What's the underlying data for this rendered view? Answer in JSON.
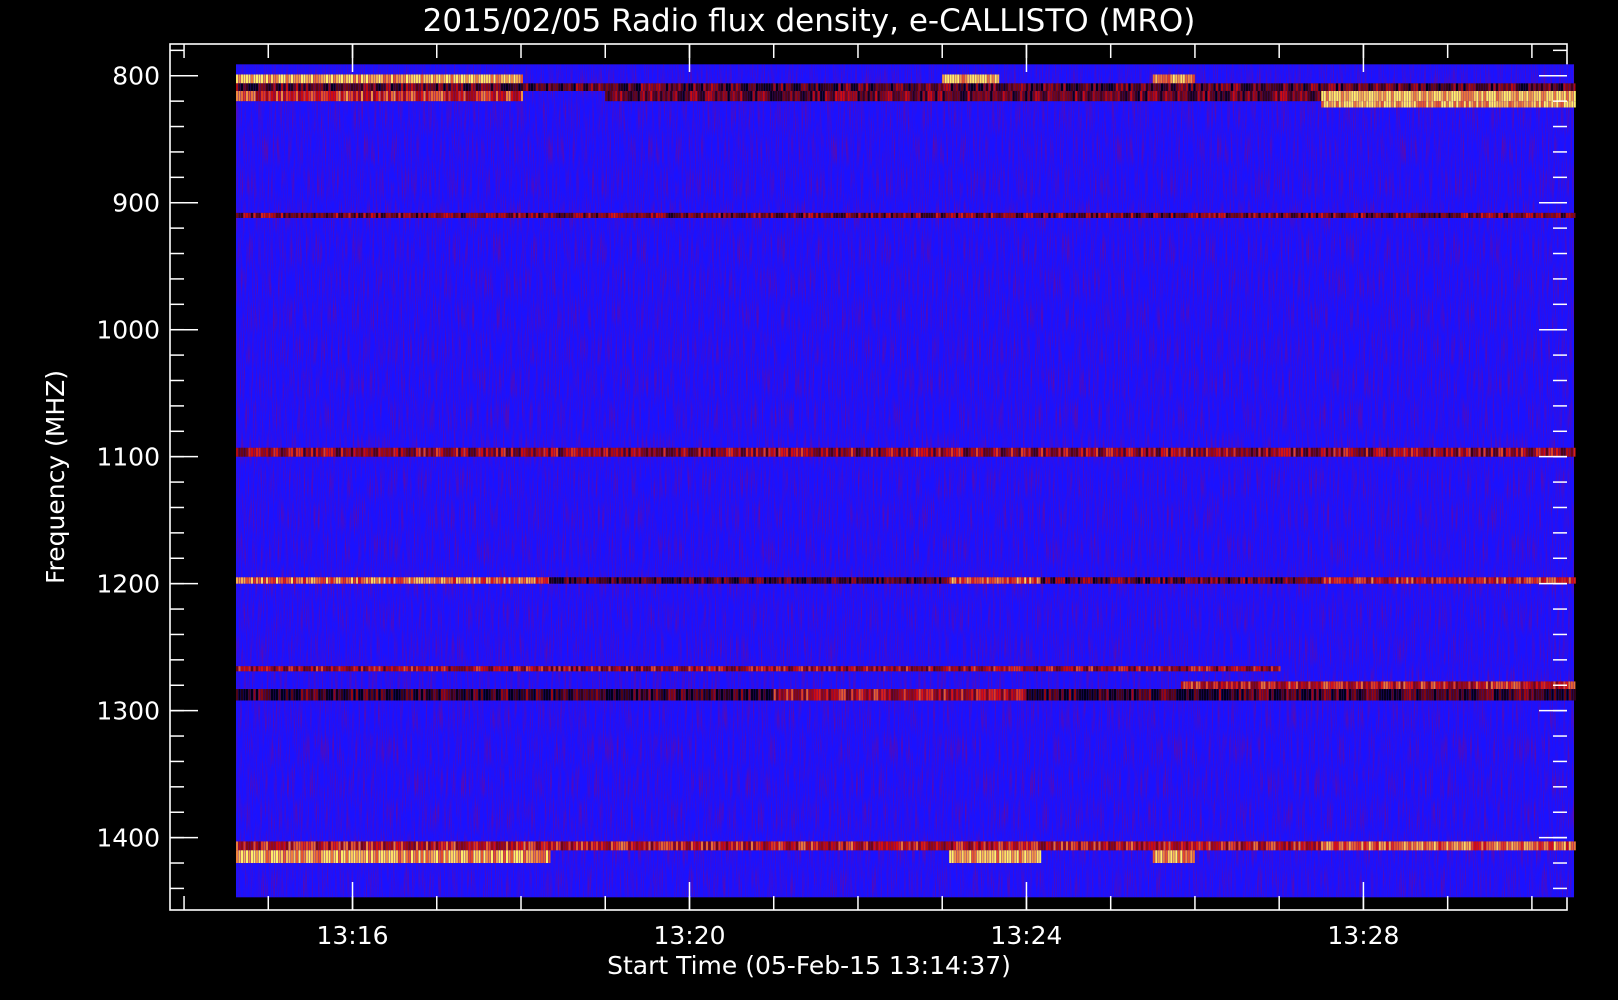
{
  "chart_data": {
    "type": "heatmap",
    "title": "2015/02/05  Radio flux density, e-CALLISTO (MRO)",
    "xlabel": "Start Time (05-Feb-15 13:14:37)",
    "ylabel": "Frequency (MHZ)",
    "x_axis": {
      "unit": "time",
      "range": [
        "13:14:37",
        "13:30:30"
      ],
      "axis_range": [
        "13:13:50",
        "13:30:25"
      ],
      "major_ticks": [
        "13:16",
        "13:20",
        "13:24",
        "13:28"
      ],
      "minor_tick_step_min": 1
    },
    "y_axis": {
      "unit": "MHz",
      "range": [
        791,
        1447
      ],
      "axis_range": [
        775,
        1457
      ],
      "inverted": true,
      "major_ticks": [
        800,
        900,
        1000,
        1100,
        1200,
        1300,
        1400
      ],
      "minor_tick_step": 20
    },
    "colormap": {
      "background": "#1a12ff",
      "low": "#000018",
      "mid": "#d80d0d",
      "high": "#fff06a"
    },
    "bands": [
      {
        "freq": [
          799,
          806
        ],
        "segments": [
          [
            "13:14:37",
            "13:18:00",
            0.9
          ],
          [
            "13:23:00",
            "13:23:40",
            0.9
          ],
          [
            "13:25:30",
            "13:26:00",
            0.8
          ]
        ]
      },
      {
        "freq": [
          806,
          812
        ],
        "segments": [
          [
            "13:14:37",
            "13:30:30",
            0.2
          ]
        ]
      },
      {
        "freq": [
          812,
          820
        ],
        "segments": [
          [
            "13:14:37",
            "13:18:00",
            0.6
          ],
          [
            "13:19:00",
            "13:27:30",
            0.25
          ],
          [
            "13:27:30",
            "13:30:30",
            0.95
          ]
        ]
      },
      {
        "freq": [
          820,
          825
        ],
        "segments": [
          [
            "13:27:30",
            "13:30:30",
            0.9
          ]
        ]
      },
      {
        "freq": [
          908,
          912
        ],
        "segments": [
          [
            "13:14:37",
            "13:30:30",
            0.3
          ]
        ]
      },
      {
        "freq": [
          1093,
          1100
        ],
        "segments": [
          [
            "13:14:37",
            "13:30:30",
            0.38
          ]
        ]
      },
      {
        "freq": [
          1195,
          1200
        ],
        "segments": [
          [
            "13:14:37",
            "13:18:20",
            0.72
          ],
          [
            "13:18:20",
            "13:23:05",
            0.15
          ],
          [
            "13:23:05",
            "13:24:10",
            0.7
          ],
          [
            "13:24:10",
            "13:27:30",
            0.22
          ],
          [
            "13:27:30",
            "13:30:30",
            0.55
          ]
        ]
      },
      {
        "freq": [
          1265,
          1269
        ],
        "segments": [
          [
            "13:14:37",
            "13:27:00",
            0.42
          ]
        ]
      },
      {
        "freq": [
          1277,
          1283
        ],
        "segments": [
          [
            "13:25:50",
            "13:30:30",
            0.5
          ]
        ]
      },
      {
        "freq": [
          1283,
          1292
        ],
        "segments": [
          [
            "13:14:37",
            "13:21:00",
            0.12
          ],
          [
            "13:21:00",
            "13:24:00",
            0.45
          ],
          [
            "13:24:00",
            "13:30:30",
            0.15
          ]
        ]
      },
      {
        "freq": [
          1403,
          1410
        ],
        "segments": [
          [
            "13:14:37",
            "13:27:30",
            0.5
          ],
          [
            "13:27:30",
            "13:30:30",
            0.72
          ]
        ]
      },
      {
        "freq": [
          1410,
          1420
        ],
        "segments": [
          [
            "13:14:37",
            "13:18:20",
            0.88
          ],
          [
            "13:23:05",
            "13:24:10",
            0.88
          ],
          [
            "13:25:30",
            "13:26:00",
            0.85
          ]
        ]
      }
    ]
  }
}
